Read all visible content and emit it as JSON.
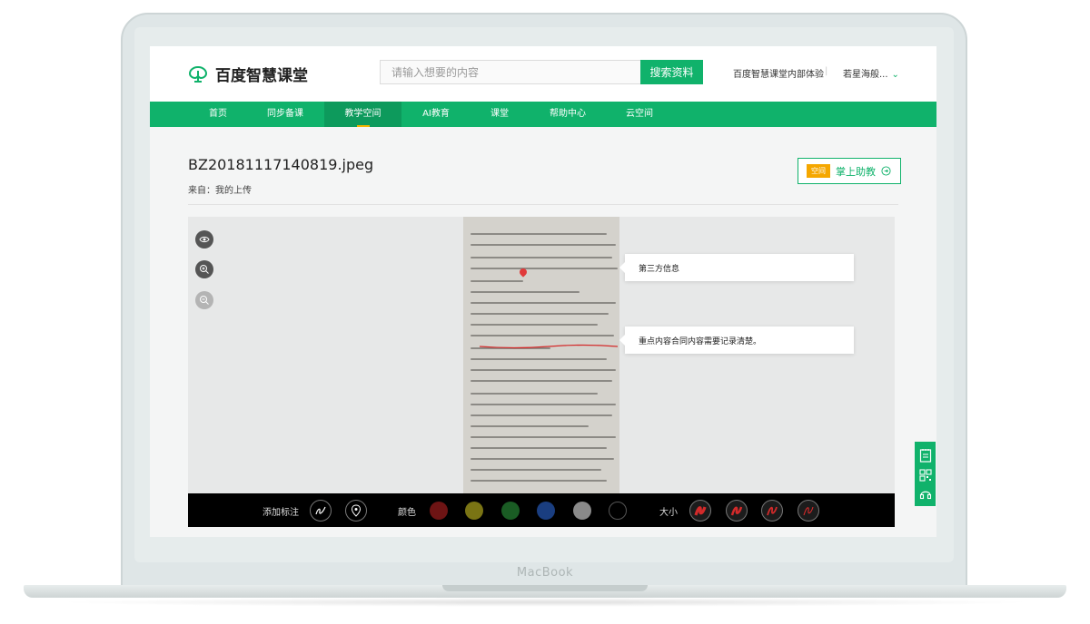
{
  "device": {
    "brand": "MacBook"
  },
  "header": {
    "logo_text": "百度智慧课堂",
    "search_placeholder": "请输入想要的内容",
    "search_button": "搜索资料",
    "internal_link": "百度智慧课堂内部体验",
    "separator": "|",
    "user_name": "若星海般..."
  },
  "nav": {
    "items": [
      {
        "label": "首页"
      },
      {
        "label": "同步备课"
      },
      {
        "label": "教学空间",
        "active": true
      },
      {
        "label": "AI教育"
      },
      {
        "label": "课堂"
      },
      {
        "label": "帮助中心"
      },
      {
        "label": "云空间"
      }
    ]
  },
  "file": {
    "title": "BZ20181117140819.jpeg",
    "source": "来自：我的上传"
  },
  "assistant": {
    "badge": "空间",
    "label": "掌上助教"
  },
  "viewer": {
    "tools": [
      "eye-icon",
      "zoom-in-icon",
      "zoom-out-icon"
    ],
    "annotations": [
      {
        "text": "第三方信息"
      },
      {
        "text": "重点内容合同内容需要记录清楚。"
      }
    ]
  },
  "toolbar": {
    "annotate_label": "添加标注",
    "color_label": "颜色",
    "size_label": "大小",
    "colors": [
      "#6e1414",
      "#7a7414",
      "#1a5c24",
      "#1a3e80",
      "#8a8a8a",
      "#000000"
    ],
    "size_color": "#d32a2a"
  },
  "side_tools": [
    "notes-icon",
    "qr-code-icon",
    "headset-icon"
  ],
  "theme": {
    "accent": "#10b26b",
    "badge": "#f5a700"
  }
}
